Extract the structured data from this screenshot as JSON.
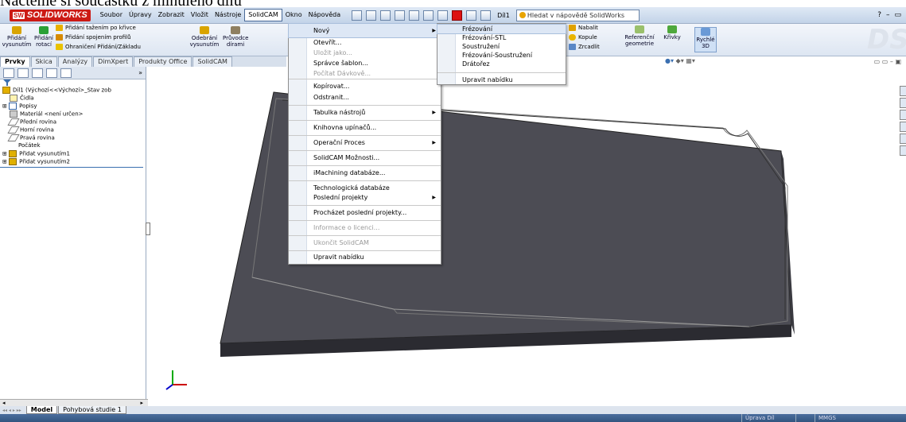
{
  "caption": "Načtěme si součástku z minulého dílu",
  "menubar": {
    "logo": "SOLIDWORKS",
    "logo_mark": "SW",
    "items": [
      "Soubor",
      "Úpravy",
      "Zobrazit",
      "Vložit",
      "Nástroje",
      "SolidCAM",
      "Okno",
      "Nápověda"
    ],
    "active": "SolidCAM",
    "doc_name": "Díl1",
    "help_placeholder": "Hledat v nápovědě SolidWorks",
    "window_controls": [
      "?",
      "–",
      "▭"
    ]
  },
  "command_manager": {
    "pridani_vysunutim": "Přidání vysunutím",
    "pridani_rotaci": "Přidání rotací",
    "pridani_tazenim": "Přidání tažením po křivce",
    "pridani_spojenim": "Přidání spojením profilů",
    "ohraniceni": "Ohraničení Přidání/Základu",
    "odebrani_vysunutim": "Odebrání vysunutím",
    "pruvodce_dirami": "Průvodce dírami",
    "nabalit": "Nabalit",
    "kopule": "Kopule",
    "zrcadlit": "Zrcadlit",
    "referencni_geometrie": "Referenční geometrie",
    "krivky": "Křivky",
    "rychle_3d": "Rychlé 3D"
  },
  "tabs": [
    "Prvky",
    "Skica",
    "Analýzy",
    "DimXpert",
    "Produkty Office",
    "SolidCAM"
  ],
  "active_tab": "Prvky",
  "feature_tree": {
    "root": "Díl1 (Výchozí<<Výchozí>_Stav zob",
    "items": [
      "Čidla",
      "Popisy",
      "Materiál <není určen>",
      "Přední rovina",
      "Horní rovina",
      "Pravá rovina",
      "Počátek",
      "Přidat vysunutím1",
      "Přidat vysunutím2"
    ]
  },
  "solidcam_menu": {
    "items": [
      {
        "label": "Nový",
        "state": "highlighted",
        "submenu": true
      },
      {
        "label": "Otevřít...",
        "state": "enabled"
      },
      {
        "label": "Uložit jako...",
        "state": "disabled"
      },
      {
        "label": "Správce šablon...",
        "state": "enabled"
      },
      {
        "label": "Počítat Dávkově...",
        "state": "disabled"
      },
      {
        "label": "Kopírovat...",
        "state": "enabled"
      },
      {
        "label": "Odstranit...",
        "state": "enabled"
      },
      {
        "label": "Tabulka nástrojů",
        "state": "enabled",
        "submenu": true
      },
      {
        "label": "Knihovna upínačů...",
        "state": "enabled"
      },
      {
        "label": "Operační Proces",
        "state": "enabled",
        "submenu": true
      },
      {
        "label": "SolidCAM Možnosti...",
        "state": "enabled"
      },
      {
        "label": "iMachining databáze...",
        "state": "enabled"
      },
      {
        "label": "Technologická databáze",
        "state": "enabled"
      },
      {
        "label": "Poslední projekty",
        "state": "enabled",
        "submenu": true
      },
      {
        "label": "Procházet poslední projekty...",
        "state": "enabled"
      },
      {
        "label": "Informace o licenci...",
        "state": "disabled"
      },
      {
        "label": "Ukončit SolidCAM",
        "state": "disabled"
      },
      {
        "label": "Upravit nabídku",
        "state": "enabled"
      }
    ]
  },
  "novy_submenu": {
    "items": [
      {
        "label": "Frézování",
        "state": "highlighted"
      },
      {
        "label": "Frézování-STL",
        "state": "enabled"
      },
      {
        "label": "Soustružení",
        "state": "enabled"
      },
      {
        "label": "Frézování-Soustružení",
        "state": "enabled"
      },
      {
        "label": "Drátořez",
        "state": "enabled"
      },
      {
        "label": "Upravit nabídku",
        "state": "enabled"
      }
    ]
  },
  "bottom_tabs": [
    "Model",
    "Pohybová studie 1"
  ],
  "active_bottom_tab": "Model",
  "status": {
    "edit": "Úprava Díl",
    "units": "MMGS"
  },
  "colors": {
    "part_top": "#505058",
    "part_side": "#2e2e34",
    "accent": "#cc1a14"
  }
}
